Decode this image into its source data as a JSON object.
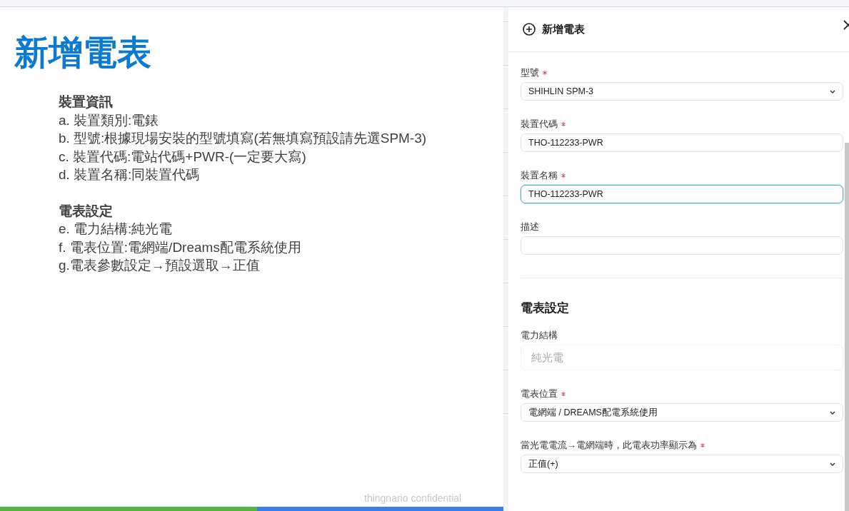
{
  "slide": {
    "title": "新增電表",
    "sections": [
      {
        "heading": "裝置資訊",
        "lines": [
          "a. 裝置類別:電錶",
          "b. 型號:根據現場安裝的型號填寫(若無填寫預設請先選SPM-3)",
          "c. 裝置代碼:電站代碼+PWR-(一定要大寫)",
          "d. 裝置名稱:同裝置代碼"
        ]
      },
      {
        "heading": "電表設定",
        "lines": [
          "e. 電力結構:純光電",
          "f. 電表位置:電網端/Dreams配電系統使用",
          "g.電表參數設定→預設選取→正值"
        ]
      }
    ],
    "footer": "thingnario confidential"
  },
  "panel": {
    "title": "新增電表",
    "items": [
      {
        "kind": "select",
        "label": "型號",
        "required": true,
        "value": "SHIHLIN SPM-3",
        "focused": false
      },
      {
        "kind": "input",
        "label": "裝置代碼",
        "required": true,
        "value": "THO-112233-PWR",
        "focused": false
      },
      {
        "kind": "input",
        "label": "裝置名稱",
        "required": true,
        "value": "THO-112233-PWR",
        "focused": true
      },
      {
        "kind": "input",
        "label": "描述",
        "required": false,
        "focused": false
      },
      {
        "kind": "divider"
      },
      {
        "kind": "heading",
        "label": "電表設定"
      },
      {
        "kind": "disabled",
        "label": "電力結構",
        "required": false,
        "value": "純光電",
        "focused": false
      },
      {
        "kind": "select",
        "label": "電表位置",
        "required": true,
        "value": "電網端 / DREAMS配電系統使用",
        "focused": false
      },
      {
        "kind": "select",
        "label": "當光電電流→電網端時，此電表功率顯示為",
        "required": true,
        "value": "正值(+)",
        "focused": false
      }
    ]
  }
}
